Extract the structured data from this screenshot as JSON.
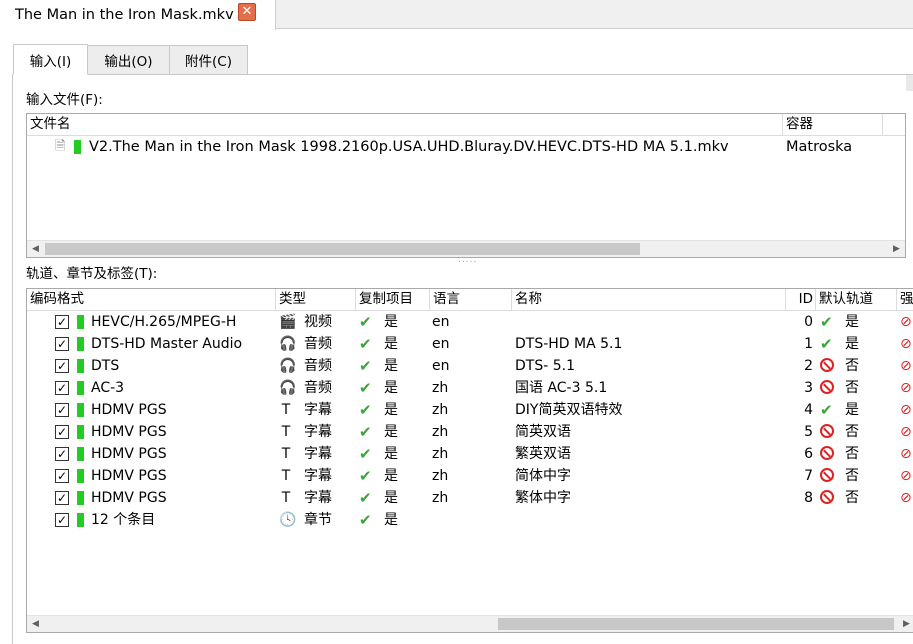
{
  "doc_tab": {
    "title": "The Man in the Iron Mask.mkv",
    "close_glyph": "✕"
  },
  "tabs": [
    {
      "label": "输入(I)"
    },
    {
      "label": "输出(O)"
    },
    {
      "label": "附件(C)"
    }
  ],
  "input_files": {
    "label": "输入文件(F):",
    "columns": [
      "文件名",
      "容器"
    ],
    "rows": [
      {
        "name": "V2.The Man in the Iron Mask 1998.2160p.USA.UHD.Bluray.DV.HEVC.DTS-HD MA 5.1.mkv",
        "container": "Matroska"
      }
    ]
  },
  "tracks": {
    "label": "轨道、章节及标签(T):",
    "columns": [
      "编码格式",
      "类型",
      "复制项目",
      "语言",
      "名称",
      "ID",
      "默认轨道",
      "强"
    ],
    "rows": [
      {
        "codec": "HEVC/H.265/MPEG-H",
        "type_icon": "film-icon",
        "type": "视频",
        "copy": "是",
        "lang": "en",
        "name": "",
        "id": "0",
        "default_icon": "check",
        "default": "是"
      },
      {
        "codec": "DTS-HD Master Audio",
        "type_icon": "headphones-icon",
        "type": "音频",
        "copy": "是",
        "lang": "en",
        "name": "DTS-HD MA 5.1",
        "id": "1",
        "default_icon": "check",
        "default": "是"
      },
      {
        "codec": "DTS",
        "type_icon": "headphones-icon",
        "type": "音频",
        "copy": "是",
        "lang": "en",
        "name": "DTS- 5.1",
        "id": "2",
        "default_icon": "no",
        "default": "否"
      },
      {
        "codec": "AC-3",
        "type_icon": "headphones-icon",
        "type": "音频",
        "copy": "是",
        "lang": "zh",
        "name": "国语 AC-3 5.1",
        "id": "3",
        "default_icon": "no",
        "default": "否"
      },
      {
        "codec": "HDMV PGS",
        "type_icon": "text-icon",
        "type": "字幕",
        "copy": "是",
        "lang": "zh",
        "name": "DIY简英双语特效",
        "id": "4",
        "default_icon": "check",
        "default": "是"
      },
      {
        "codec": "HDMV PGS",
        "type_icon": "text-icon",
        "type": "字幕",
        "copy": "是",
        "lang": "zh",
        "name": "简英双语",
        "id": "5",
        "default_icon": "no",
        "default": "否"
      },
      {
        "codec": "HDMV PGS",
        "type_icon": "text-icon",
        "type": "字幕",
        "copy": "是",
        "lang": "zh",
        "name": "繁英双语",
        "id": "6",
        "default_icon": "no",
        "default": "否"
      },
      {
        "codec": "HDMV PGS",
        "type_icon": "text-icon",
        "type": "字幕",
        "copy": "是",
        "lang": "zh",
        "name": "简体中字",
        "id": "7",
        "default_icon": "no",
        "default": "否"
      },
      {
        "codec": "HDMV PGS",
        "type_icon": "text-icon",
        "type": "字幕",
        "copy": "是",
        "lang": "zh",
        "name": "繁体中字",
        "id": "8",
        "default_icon": "no",
        "default": "否"
      },
      {
        "codec": "12 个条目",
        "type_icon": "clock-icon",
        "type": "章节",
        "copy": "是",
        "lang": "",
        "name": "",
        "id": "",
        "default_icon": "",
        "default": ""
      }
    ]
  },
  "colors": {
    "track_enabled": "#22cc22",
    "check": "#3aa63a",
    "no": "#dd2222",
    "close_button": "#e36e4a"
  }
}
